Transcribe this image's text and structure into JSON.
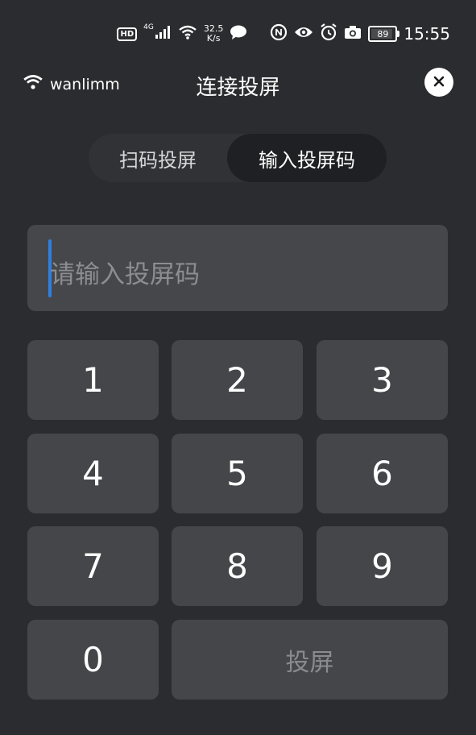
{
  "status_bar": {
    "hd": "HD",
    "network": "4G",
    "speed_value": "32.5",
    "speed_unit": "K/s",
    "battery": "89",
    "time": "15:55"
  },
  "header": {
    "wifi_name": "wanlimm",
    "title": "连接投屏"
  },
  "tabs": [
    {
      "label": "扫码投屏",
      "active": false
    },
    {
      "label": "输入投屏码",
      "active": true
    }
  ],
  "code_input": {
    "placeholder": "请输入投屏码",
    "value": ""
  },
  "keypad": {
    "k1": "1",
    "k2": "2",
    "k3": "3",
    "k4": "4",
    "k5": "5",
    "k6": "6",
    "k7": "7",
    "k8": "8",
    "k9": "9",
    "k0": "0",
    "cast_label": "投屏"
  },
  "colors": {
    "background": "#2b2c2f",
    "key": "#45464a",
    "cursor": "#2f7fe0",
    "active_tab": "#1f2023"
  },
  "icons": [
    "hd-icon",
    "signal-icon",
    "wifi-icon",
    "message-icon",
    "nfc-icon",
    "eye-icon",
    "alarm-icon",
    "camera-icon",
    "battery-icon",
    "close-icon"
  ]
}
